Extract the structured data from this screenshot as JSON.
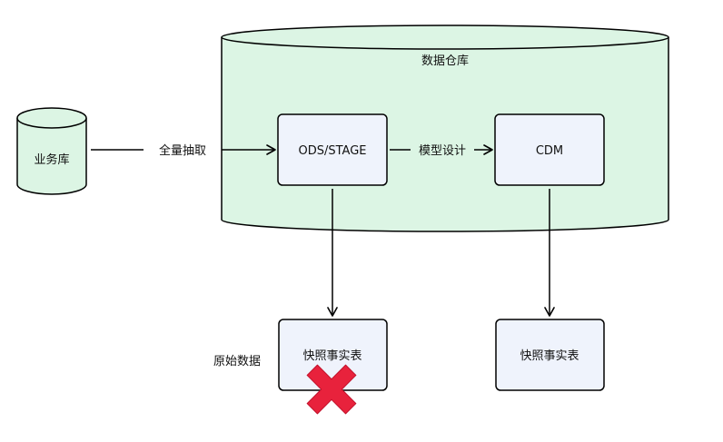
{
  "colors": {
    "warehouse_fill": "#dcf5e4",
    "source_db_fill": "#dcf5e4",
    "box_fill": "#eff3fc",
    "stroke": "#000000",
    "cross": "#e8223c"
  },
  "warehouse": {
    "label": "数据仓库"
  },
  "source_db": {
    "label": "业务库"
  },
  "ods_box": {
    "label": "ODS/STAGE"
  },
  "cdm_box": {
    "label": "CDM"
  },
  "snapshot_left": {
    "label": "快照事实表",
    "side_label": "原始数据",
    "crossed_out": true
  },
  "snapshot_right": {
    "label": "快照事实表"
  },
  "edges": {
    "extract": {
      "label": "全量抽取"
    },
    "model": {
      "label": "模型设计"
    }
  }
}
